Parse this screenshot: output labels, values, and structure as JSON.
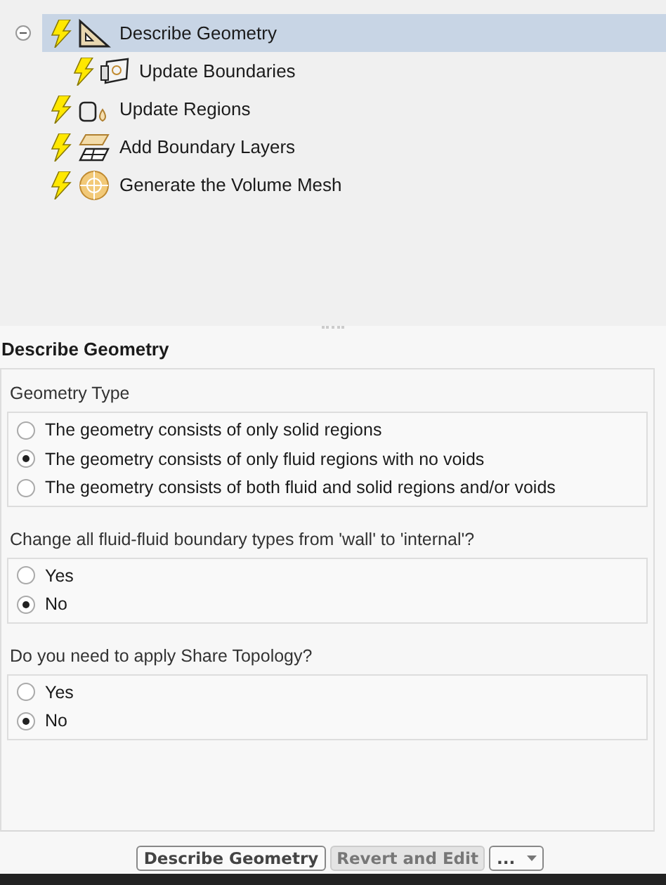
{
  "tree": {
    "items": [
      {
        "label": "Describe Geometry",
        "kind": "geometry",
        "selected": true,
        "expanded": true,
        "children": [
          {
            "label": "Update Boundaries",
            "kind": "boundaries",
            "selected": false
          }
        ]
      },
      {
        "label": "Update Regions",
        "kind": "regions",
        "selected": false
      },
      {
        "label": "Add Boundary Layers",
        "kind": "layers",
        "selected": false
      },
      {
        "label": "Generate the Volume Mesh",
        "kind": "mesh",
        "selected": false
      }
    ]
  },
  "panel": {
    "title": "Describe Geometry",
    "questions": [
      {
        "label": "Geometry Type",
        "options": [
          {
            "label": "The geometry consists of only solid regions",
            "selected": false
          },
          {
            "label": "The geometry consists of only fluid regions with no voids",
            "selected": true
          },
          {
            "label": "The geometry consists of both fluid and solid regions and/or voids",
            "selected": false
          }
        ]
      },
      {
        "label": "Change all fluid-fluid boundary types from 'wall' to 'internal'?",
        "options": [
          {
            "label": "Yes",
            "selected": false
          },
          {
            "label": "No",
            "selected": true
          }
        ]
      },
      {
        "label": "Do you need to apply Share Topology?",
        "options": [
          {
            "label": "Yes",
            "selected": false
          },
          {
            "label": "No",
            "selected": true
          }
        ]
      }
    ]
  },
  "buttons": [
    {
      "label": "Describe Geometry",
      "kind": "primary"
    },
    {
      "label": "Revert and Edit",
      "kind": "disabled"
    },
    {
      "label": "...",
      "kind": "dropdown"
    }
  ]
}
